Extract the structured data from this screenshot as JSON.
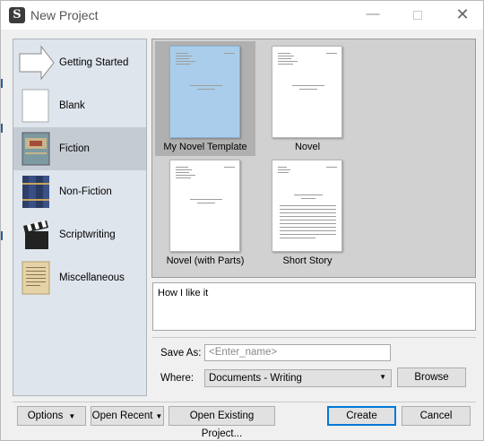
{
  "window": {
    "title": "New Project",
    "controls": {
      "minimize": "—",
      "close": "✕"
    }
  },
  "categories": [
    {
      "label": "Getting Started",
      "icon": "arrow-icon"
    },
    {
      "label": "Blank",
      "icon": "blank-page-icon"
    },
    {
      "label": "Fiction",
      "icon": "fiction-book-icon",
      "selected": true
    },
    {
      "label": "Non-Fiction",
      "icon": "books-icon"
    },
    {
      "label": "Scriptwriting",
      "icon": "clapperboard-icon"
    },
    {
      "label": "Miscellaneous",
      "icon": "parchment-icon"
    }
  ],
  "templates": [
    {
      "label": "My Novel Template",
      "selected": true
    },
    {
      "label": "Novel"
    },
    {
      "label": "Novel (with Parts)"
    },
    {
      "label": "Short Story"
    }
  ],
  "description": "How I like it",
  "save_as": {
    "label": "Save As:",
    "placeholder": "<Enter_name>"
  },
  "where": {
    "label": "Where:",
    "value": "Documents - Writing"
  },
  "buttons": {
    "browse": "Browse",
    "options": "Options",
    "open_recent": "Open Recent",
    "open_existing": "Open Existing Project...",
    "create": "Create",
    "cancel": "Cancel"
  },
  "colors": {
    "accent": "#0078d7",
    "selected_template": "#a9cdea"
  }
}
